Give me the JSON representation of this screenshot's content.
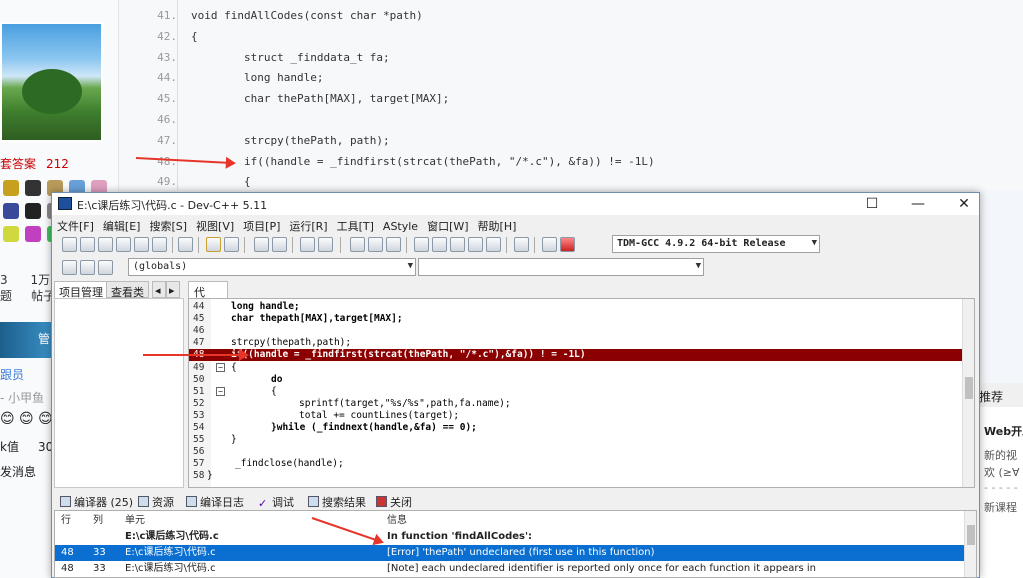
{
  "bg_page": {
    "answers_label": "套答案",
    "answers_count": "212",
    "stats": [
      "3",
      "1万",
      "题",
      "帖子"
    ],
    "banner_text": "管",
    "member_label": "跟员",
    "member_name": "- 小甲鱼",
    "value_label": "k值",
    "value_num": "30",
    "send_label": "发消息",
    "right_header": "推荐",
    "right_title": "Web开发",
    "right_line1": "新的视",
    "right_line2": "欢 (≥∀",
    "right_line3": "- - - - -",
    "right_line4": "新课程",
    "code_lines": [
      {
        "num": "41.",
        "text": "void findAllCodes(const char *path)"
      },
      {
        "num": "42.",
        "text": "{"
      },
      {
        "num": "43.",
        "text": "        struct _finddata_t fa;"
      },
      {
        "num": "44.",
        "text": "        long handle;"
      },
      {
        "num": "45.",
        "text": "        char thePath[MAX], target[MAX];"
      },
      {
        "num": "46.",
        "text": ""
      },
      {
        "num": "47.",
        "text": "        strcpy(thePath, path);"
      },
      {
        "num": "48.",
        "text": "        if((handle = _findfirst(strcat(thePath, \"/*.c\"), &fa)) != -1L)"
      },
      {
        "num": "49.",
        "text": "        {"
      }
    ]
  },
  "window": {
    "title": "E:\\c课后练习\\代码.c - Dev-C++ 5.11",
    "minimize": "—",
    "maximize": "☐",
    "close": "✕"
  },
  "menu": [
    "文件[F]",
    "编辑[E]",
    "搜索[S]",
    "视图[V]",
    "项目[P]",
    "运行[R]",
    "工具[T]",
    "AStyle",
    "窗口[W]",
    "帮助[H]"
  ],
  "compiler_select": "TDM-GCC 4.9.2 64-bit Release",
  "scope_select": "(globals)",
  "left_tabs": [
    "项目管理",
    "查看类"
  ],
  "editor_tab": "代码.c",
  "editor_lines": [
    {
      "num": "44",
      "text": "long handle;"
    },
    {
      "num": "45",
      "text": "char thepath[MAX],target[MAX];"
    },
    {
      "num": "46",
      "text": ""
    },
    {
      "num": "47",
      "text": "strcpy(thepath,path);"
    },
    {
      "num": "48",
      "text": "if((handle = _findfirst(strcat(thePath, \"/*.c\"),&fa)) ! = -1L)"
    },
    {
      "num": "49",
      "text": "{"
    },
    {
      "num": "50",
      "text": "do"
    },
    {
      "num": "51",
      "text": "{"
    },
    {
      "num": "52",
      "text": "sprintf(target,\"%s/%s\",path,fa.name);"
    },
    {
      "num": "53",
      "text": "total += countLines(target);"
    },
    {
      "num": "54",
      "text": "}while (_findnext(handle,&fa) == 0);"
    },
    {
      "num": "55",
      "text": "}"
    },
    {
      "num": "56",
      "text": ""
    },
    {
      "num": "57",
      "text": "_findclose(handle);"
    },
    {
      "num": "58",
      "text": "}"
    }
  ],
  "bottom_tabs": [
    "编译器 (25)",
    "资源",
    "编译日志",
    "调试",
    "搜索结果",
    "关闭"
  ],
  "results": {
    "headers": [
      "行",
      "列",
      "单元",
      "信息"
    ],
    "rows": [
      {
        "line": "",
        "col": "",
        "unit": "E:\\c课后练习\\代码.c",
        "msg": "In function 'findAllCodes':"
      },
      {
        "line": "48",
        "col": "33",
        "unit": "E:\\c课后练习\\代码.c",
        "msg": "[Error] 'thePath' undeclared (first use in this function)"
      },
      {
        "line": "48",
        "col": "33",
        "unit": "E:\\c课后练习\\代码.c",
        "msg": "[Note] each undeclared identifier is reported only once for each function it appears in"
      }
    ]
  },
  "colors": {
    "error_line": "#8b0000",
    "selection": "#0a6fd1",
    "arrow": "#e8352a"
  }
}
